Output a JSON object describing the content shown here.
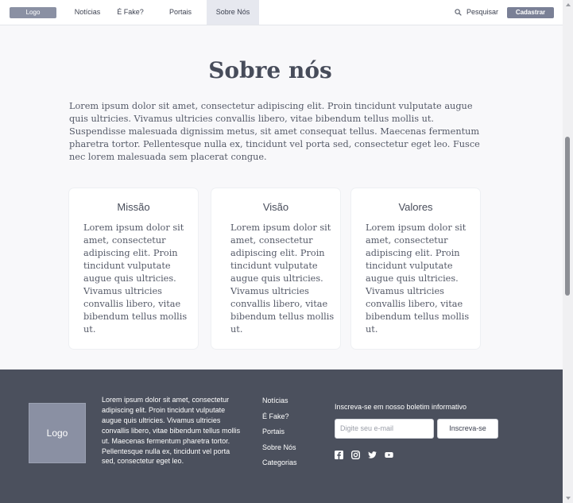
{
  "nav": {
    "logo": "Logo",
    "items": [
      "Notícias",
      "É Fake?",
      "Portais",
      "Sobre Nós"
    ],
    "search_label": "Pesquisar",
    "signup": "Cadastrar"
  },
  "main": {
    "title": "Sobre nós",
    "intro": "Lorem ipsum dolor sit amet, consectetur adipiscing elit. Proin tincidunt vulputate augue quis ultricies. Vivamus ultricies convallis libero, vitae bibendum tellus mollis ut. Suspendisse malesuada dignissim metus, sit amet consequat tellus. Maecenas fermentum pharetra tortor. Pellentesque nulla ex, tincidunt vel porta sed, consectetur eget leo. Fusce nec lorem malesuada sem placerat congue.",
    "cards": [
      {
        "title": "Missão",
        "text": "Lorem ipsum dolor sit amet, consectetur adipiscing elit. Proin tincidunt vulputate augue quis ultricies. Vivamus ultricies convallis libero, vitae bibendum tellus mollis ut."
      },
      {
        "title": "Visão",
        "text": "Lorem ipsum dolor sit amet, consectetur adipiscing elit. Proin tincidunt vulputate augue quis ultricies. Vivamus ultricies convallis libero, vitae bibendum tellus mollis ut."
      },
      {
        "title": "Valores",
        "text": "Lorem ipsum dolor sit amet, consectetur adipiscing elit. Proin tincidunt vulputate augue quis ultricies. Vivamus ultricies convallis libero, vitae bibendum tellus mollis ut."
      }
    ]
  },
  "footer": {
    "logo": "Logo",
    "about": "Lorem ipsum dolor sit amet, consectetur adipiscing elit. Proin tincidunt vulputate augue quis ultricies. Vivamus ultricies convallis libero, vitae bibendum tellus mollis ut. Maecenas fermentum pharetra tortor. Pellentesque nulla ex, tincidunt vel porta sed, consectetur eget leo.",
    "links": [
      "Notícias",
      "É Fake?",
      "Portais",
      "Sobre Nós",
      "Categorias"
    ],
    "newsletter_title": "Inscreva-se em nosso boletim informativo",
    "email_placeholder": "Digite seu e-mail",
    "subscribe": "Inscreva-se",
    "social_icons": [
      "facebook-icon",
      "instagram-icon",
      "twitter-icon",
      "youtube-icon"
    ]
  },
  "colors": {
    "page_bg": "#f8f8fa",
    "footer_bg": "#4b505d",
    "button_gray": "#8a90a3",
    "active_tab": "#e6e8ef"
  }
}
